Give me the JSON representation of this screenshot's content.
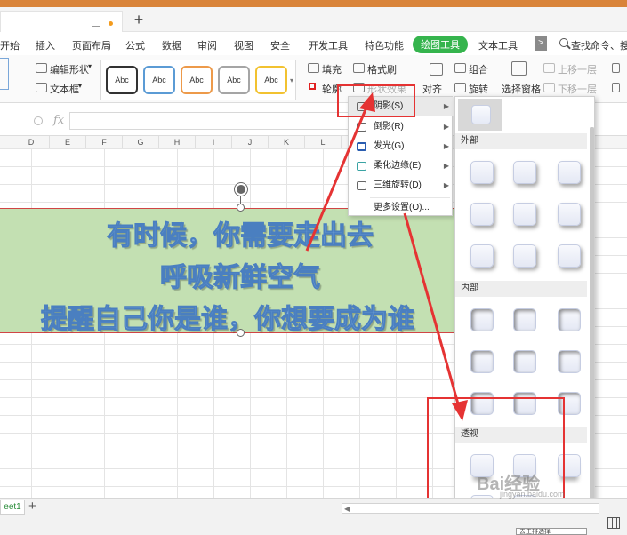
{
  "window": {
    "accent": "#d9843a"
  },
  "menu": {
    "items": [
      "开始",
      "插入",
      "页面布局",
      "公式",
      "数据",
      "审阅",
      "视图",
      "安全",
      "开发工具",
      "特色功能",
      "绘图工具",
      "文本工具"
    ],
    "active_label": "绘图工具",
    "active_color": "#35b44d",
    "more_label": ">",
    "search_label": "查找命令、搜索"
  },
  "ribbon": {
    "edit_shape": "编辑形状",
    "text_box": "文本框",
    "style_labels": [
      "Abc",
      "Abc",
      "Abc",
      "Abc",
      "Abc"
    ],
    "style_colors": [
      "#333333",
      "#5b9bd5",
      "#ed9a4a",
      "#a5a5a5",
      "#f2c230"
    ],
    "fill": "填充",
    "format_painter": "格式刷",
    "outline": "轮廓",
    "shape_effects": "形状效果",
    "align": "对齐",
    "group": "组合",
    "rotate": "旋转",
    "selection_pane": "选择窗格",
    "bring_forward": "上移一层",
    "send_backward": "下移一层"
  },
  "formula_bar": {
    "fx": "fx"
  },
  "columns": [
    "D",
    "E",
    "F",
    "G",
    "H",
    "I",
    "J",
    "K",
    "L"
  ],
  "wordart": {
    "lines": [
      "有时候，你需要走出去",
      "呼吸新鲜空气",
      "提醒自己你是谁，你想要成为谁"
    ]
  },
  "effects_menu": [
    {
      "label": "阴影(S)",
      "icon": "shadow-icon",
      "submenu": true
    },
    {
      "label": "倒影(R)",
      "icon": "reflection-icon",
      "submenu": true
    },
    {
      "label": "发光(G)",
      "icon": "glow-icon",
      "submenu": true
    },
    {
      "label": "柔化边缘(E)",
      "icon": "soft-edge-icon",
      "submenu": true
    },
    {
      "label": "三维旋转(D)",
      "icon": "3d-rotation-icon",
      "submenu": true
    },
    {
      "label": "更多设置(O)...",
      "icon": "",
      "submenu": false
    }
  ],
  "shadow_panel": {
    "sections": [
      "外部",
      "内部",
      "透视"
    ]
  },
  "sheet": {
    "tab": "eet1"
  },
  "watermark": {
    "main": "Bai经验",
    "sub": "jingyan.baidu.com"
  },
  "tooltip": {
    "text": "去工排选择"
  }
}
